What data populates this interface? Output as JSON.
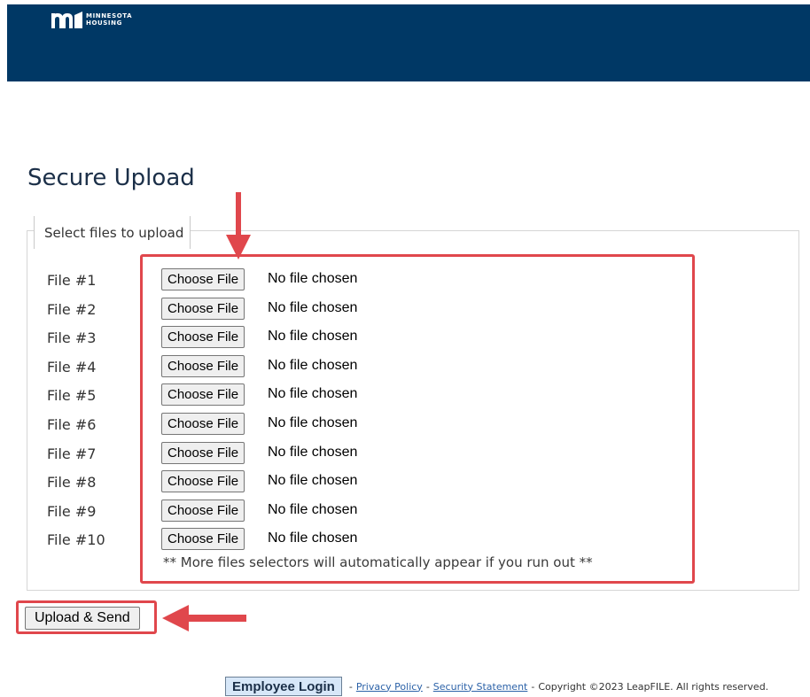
{
  "header": {
    "logo_line1": "MINNESOTA",
    "logo_line2": "HOUSING",
    "background_color": "#003865"
  },
  "page_title": "Secure Upload",
  "upload": {
    "legend": "Select files to upload",
    "choose_label": "Choose File",
    "no_file_text": "No file chosen",
    "files": [
      {
        "label": "File #1"
      },
      {
        "label": "File #2"
      },
      {
        "label": "File #3"
      },
      {
        "label": "File #4"
      },
      {
        "label": "File #5"
      },
      {
        "label": "File #6"
      },
      {
        "label": "File #7"
      },
      {
        "label": "File #8"
      },
      {
        "label": "File #9"
      },
      {
        "label": "File #10"
      }
    ],
    "note": "** More files selectors will automatically appear if you run out **",
    "submit_label": "Upload & Send"
  },
  "annotations": {
    "highlight_color": "#e0474c"
  },
  "footer": {
    "employee_login": "Employee Login",
    "separator": "-",
    "privacy_policy": "Privacy Policy",
    "security_statement": "Security Statement",
    "copyright": "Copyright ©2023 LeapFILE. All rights reserved."
  }
}
